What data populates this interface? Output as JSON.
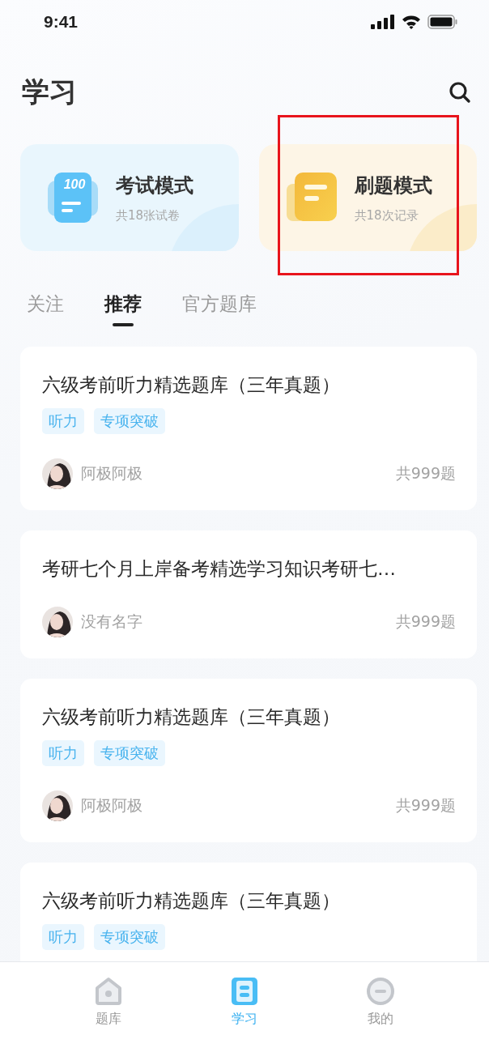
{
  "status_bar": {
    "time": "9:41"
  },
  "header": {
    "title": "学习"
  },
  "modes": [
    {
      "kind": "exam",
      "icon_text": "100",
      "title": "考试模式",
      "subtitle": "共18张试卷",
      "highlighted": false
    },
    {
      "kind": "practice",
      "title": "刷题模式",
      "subtitle": "共18次记录",
      "highlighted": true
    }
  ],
  "tabs": [
    {
      "label": "关注",
      "selected": false
    },
    {
      "label": "推荐",
      "selected": true
    },
    {
      "label": "官方题库",
      "selected": false
    }
  ],
  "items": [
    {
      "title": "六级考前听力精选题库（三年真题）",
      "tags": [
        "听力",
        "专项突破"
      ],
      "author": "阿极阿极",
      "count": "共999题"
    },
    {
      "title": "考研七个月上岸备考精选学习知识考研七…",
      "author": "没有名字",
      "count": "共999题"
    },
    {
      "title": "六级考前听力精选题库（三年真题）",
      "tags": [
        "听力",
        "专项突破"
      ],
      "author": "阿极阿极",
      "count": "共999题"
    },
    {
      "title": "六级考前听力精选题库（三年真题）",
      "tags": [
        "听力",
        "专项突破"
      ]
    }
  ],
  "tab_bar": [
    {
      "kind": "home",
      "label": "题库",
      "selected": false
    },
    {
      "kind": "study",
      "label": "学习",
      "selected": true
    },
    {
      "kind": "profile",
      "label": "我的",
      "selected": false
    }
  ]
}
